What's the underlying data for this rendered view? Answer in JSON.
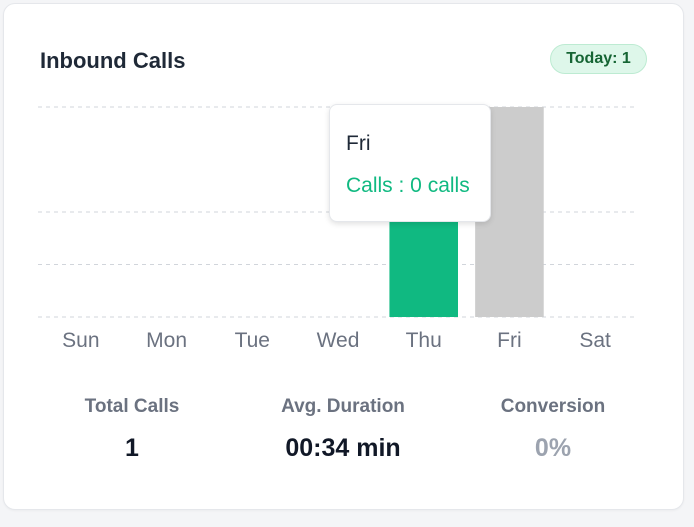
{
  "card": {
    "title": "Inbound Calls",
    "badge": "Today: 1"
  },
  "chart_data": {
    "type": "bar",
    "categories": [
      "Sun",
      "Mon",
      "Tue",
      "Wed",
      "Thu",
      "Fri",
      "Sat"
    ],
    "series": [
      {
        "name": "Calls",
        "values": [
          0,
          0,
          0,
          0,
          1,
          0,
          0
        ]
      }
    ],
    "ylim": [
      0,
      1
    ],
    "grid": true,
    "active_category": "Fri",
    "colors": {
      "bar": "#10b981",
      "hover": "#cccccc",
      "grid": "#d1d5db",
      "tick": "#6b7280"
    }
  },
  "tooltip": {
    "title": "Fri",
    "value": "Calls : 0 calls"
  },
  "stats": [
    {
      "label": "Total Calls",
      "value": "1"
    },
    {
      "label": "Avg. Duration",
      "value": "00:34 min"
    },
    {
      "label": "Conversion",
      "value": "0%"
    }
  ]
}
